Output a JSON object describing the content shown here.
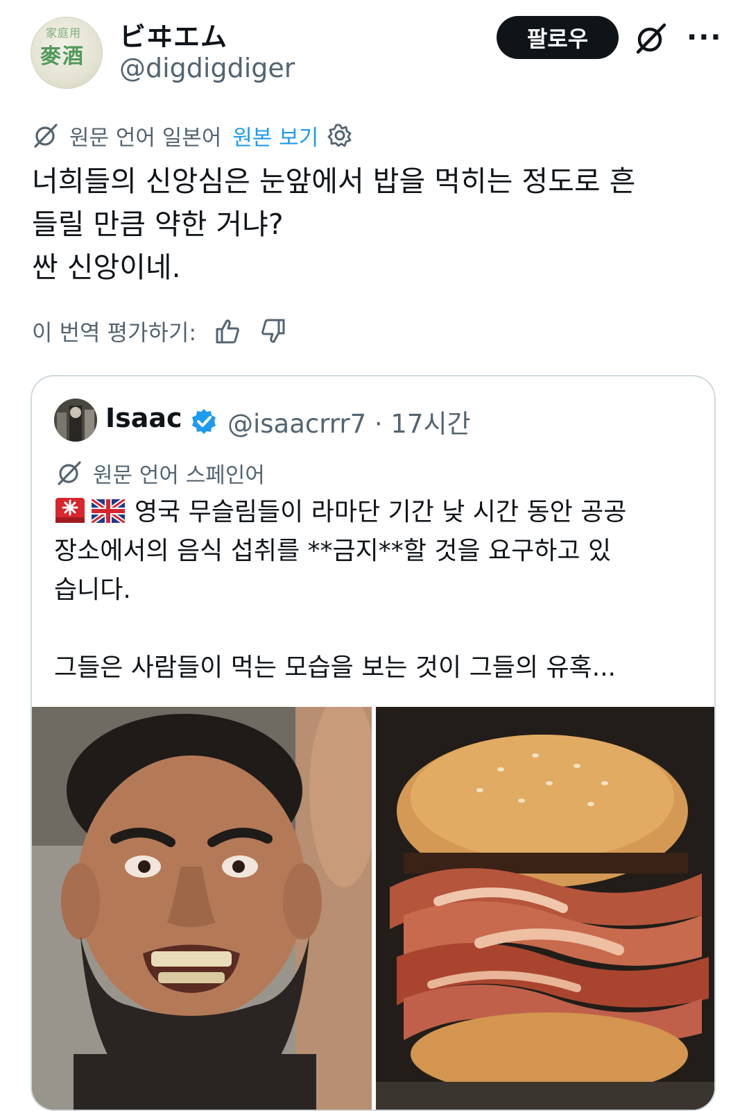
{
  "author": {
    "display_name": "ビヰエム",
    "handle": "@digdigdiger",
    "avatar_text_top": "家庭用",
    "avatar_text_main": "麥酒"
  },
  "actions": {
    "follow_label": "팔로우",
    "grok_icon": "grok-icon",
    "more_icon": "more-icon"
  },
  "translation": {
    "source_label": "원문 언어 일본어",
    "show_original": "원본 보기"
  },
  "tweet": {
    "lines": [
      "너희들의 신앙심은 눈앞에서 밥을 먹히는 정도로 흔",
      "들릴 만큼 약한 거냐?",
      "싼 신앙이네."
    ]
  },
  "rating": {
    "label": "이 번역 평가하기:"
  },
  "quote": {
    "name": "Isaac",
    "handle_time": "@isaacrrr7 · 17시간",
    "translation_label": "원문 언어 스페인어",
    "lines": [
      "영국 무슬림들이 라마단 기간 낮 시간 동안 공공",
      "장소에서의 음식 섭취를 **금지**할 것을 요구하고 있",
      "습니다.",
      "",
      "그들은 사람들이 먹는 모습을 보는 것이 그들의 유혹..."
    ],
    "images": [
      "angry bearded man",
      "bacon burger"
    ]
  },
  "colors": {
    "text": "#0f1419",
    "secondary": "#536471",
    "accent": "#1d9bf0",
    "border": "#cfd9de"
  }
}
